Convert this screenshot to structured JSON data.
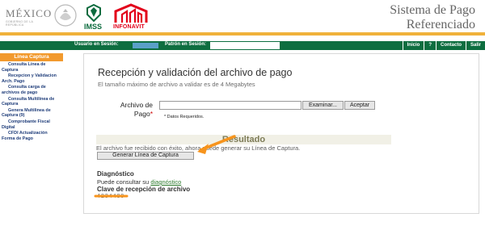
{
  "header": {
    "mexico_name": "MÉXICO",
    "mexico_sub": "GOBIERNO DE LA REPÚBLICA",
    "imss_logo_text": "IMSS",
    "infonavit_logo_text": "INFONAVIT",
    "title_line1": "Sistema de Pago",
    "title_line2": "Referenciado"
  },
  "navbar": {
    "user_label": "Usuario en Sesión:",
    "patron_label": "Patrón en Sesión:",
    "patron_value": "",
    "links": [
      "Inicio",
      "?",
      "Contacto",
      "Salir"
    ]
  },
  "sidebar": {
    "title": "Línea Captura",
    "items": [
      {
        "label_line1": "Consulta Línea de",
        "label_line2": "Captura",
        "indented": true
      },
      {
        "label_line1": "Recepcion y Validacion",
        "label_line2": "Arch. Pago",
        "indented": true
      },
      {
        "label_line1": "Consulta carga de",
        "label_line2": "archivos de pago",
        "indented": true
      },
      {
        "label_line1": "Consulta Multilinea de",
        "label_line2": "Captura",
        "indented": true
      },
      {
        "label_line1": "Genera Multilinea de",
        "label_line2": "Captura (9)",
        "indented": true
      },
      {
        "label_line1": "Comprobante Fiscal",
        "label_line2": "Digital",
        "indented": true
      },
      {
        "label_line1": "CFDI Actualización",
        "label_line2": "Forma de Pago",
        "indented": true
      }
    ]
  },
  "main": {
    "title": "Recepción y validación del archivo de pago",
    "subtitle": "El tamaño máximo de archivo a validar es de 4 Megabytes",
    "file_label_line1": "Archivo de",
    "file_label_line2": "Pago",
    "required_mark": "*",
    "file_value": "",
    "browse_label": "Examinar...",
    "accept_label": "Aceptar",
    "required_note": "* Datos Requeridos.",
    "result_title": "Resultado",
    "result_message": "El archivo fue recibido con éxito, ahora puede generar su Línea de Captura.",
    "generate_label": "Generar Línea de Captura",
    "diagnostic_title": "Diagnóstico",
    "diagnostic_text": "Puede consultar su",
    "diagnostic_link": "diagnóstico",
    "clave_title": "Clave de recepción de archivo",
    "clave_value": "4234489"
  },
  "colors": {
    "nav_green": "#0e6e40",
    "gold": "#f0b13a",
    "sidebar_orange": "#f29a2e",
    "link_blue": "#1f3d7a",
    "annotation_orange": "#f7941d"
  }
}
